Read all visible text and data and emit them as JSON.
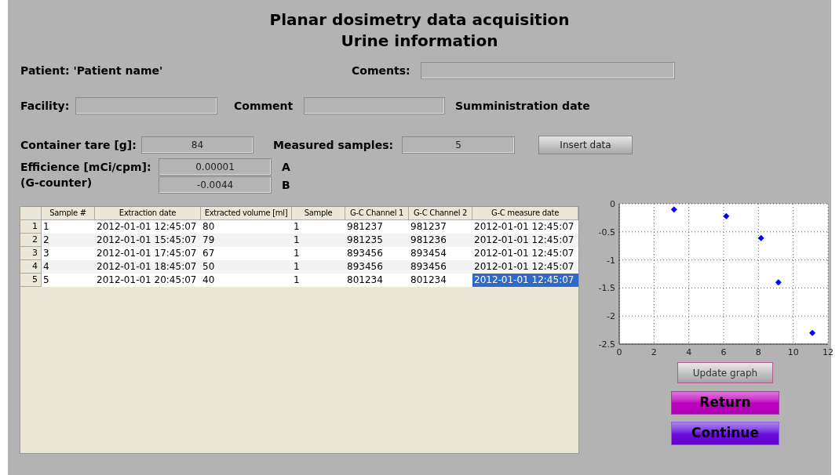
{
  "title": [
    "Planar dosimetry data acquisition",
    "Urine information"
  ],
  "patient_label": "Patient: 'Patient name'",
  "coments": {
    "label": "Coments:"
  },
  "facility": {
    "label": "Facility:"
  },
  "comment": {
    "label": "Comment"
  },
  "administration_label": "Sumministration date",
  "container_tare": {
    "label": "Container tare [g]:",
    "value": "84"
  },
  "measured_samples": {
    "label": "Measured samples:",
    "value": "5"
  },
  "insert_button": "Insert data",
  "efficiency": {
    "label": "Efficience [mCi/cpm]:",
    "sublabel": "(G-counter)",
    "a": {
      "value": "0.00001",
      "label": "A"
    },
    "b": {
      "value": "-0.0044",
      "label": "B"
    }
  },
  "table": {
    "columns": [
      "Sample #",
      "Extraction date",
      "Extracted volume [ml]",
      "Sample",
      "G-C Channel 1",
      "G-C Channel 2",
      "G-C measure date"
    ],
    "rows": [
      {
        "number": "1",
        "cells": [
          {
            "text": "1",
            "selected": false
          },
          {
            "text": "2012-01-01 12:45:07",
            "selected": false
          },
          {
            "text": "80",
            "selected": false
          },
          {
            "text": "1",
            "selected": false
          },
          {
            "text": "981237",
            "selected": false
          },
          {
            "text": "981237",
            "selected": false
          },
          {
            "text": "2012-01-01 12:45:07",
            "selected": false
          }
        ]
      },
      {
        "number": "2",
        "cells": [
          {
            "text": "2",
            "selected": false
          },
          {
            "text": "2012-01-01 15:45:07",
            "selected": false
          },
          {
            "text": "79",
            "selected": false
          },
          {
            "text": "1",
            "selected": false
          },
          {
            "text": "981235",
            "selected": false
          },
          {
            "text": "981236",
            "selected": false
          },
          {
            "text": "2012-01-01 12:45:07",
            "selected": false
          }
        ]
      },
      {
        "number": "3",
        "cells": [
          {
            "text": "3",
            "selected": false
          },
          {
            "text": "2012-01-01 17:45:07",
            "selected": false
          },
          {
            "text": "67",
            "selected": false
          },
          {
            "text": "1",
            "selected": false
          },
          {
            "text": "893456",
            "selected": false
          },
          {
            "text": "893454",
            "selected": false
          },
          {
            "text": "2012-01-01 12:45:07",
            "selected": false
          }
        ]
      },
      {
        "number": "4",
        "cells": [
          {
            "text": "4",
            "selected": false
          },
          {
            "text": "2012-01-01 18:45:07",
            "selected": false
          },
          {
            "text": "50",
            "selected": false
          },
          {
            "text": "1",
            "selected": false
          },
          {
            "text": "893456",
            "selected": false
          },
          {
            "text": "893456",
            "selected": false
          },
          {
            "text": "2012-01-01 12:45:07",
            "selected": false
          }
        ]
      },
      {
        "number": "5",
        "cells": [
          {
            "text": "5",
            "selected": false
          },
          {
            "text": "2012-01-01 20:45:07",
            "selected": false
          },
          {
            "text": "40",
            "selected": false
          },
          {
            "text": "1",
            "selected": false
          },
          {
            "text": "801234",
            "selected": false
          },
          {
            "text": "801234",
            "selected": false
          },
          {
            "text": "2012-01-01 12:45:07",
            "selected": true
          }
        ]
      }
    ]
  },
  "chart_data": {
    "type": "scatter",
    "x": [
      3.15,
      6.15,
      8.15,
      9.15,
      11.1
    ],
    "grid": true,
    "series": [
      {
        "color": "#0000ff",
        "values": [
          -0.1,
          -0.22,
          -0.61,
          -1.4,
          -2.3
        ]
      }
    ],
    "xlim": [
      0,
      12
    ],
    "ylim": [
      -2.5,
      0
    ],
    "xticks": [
      0,
      2,
      4,
      6,
      8,
      10,
      12
    ],
    "yticks": [
      0,
      -0.5,
      -1,
      -1.5,
      -2,
      -2.5
    ]
  },
  "update_button": "Update graph",
  "return_button": "Return",
  "continue_button": "Continue"
}
